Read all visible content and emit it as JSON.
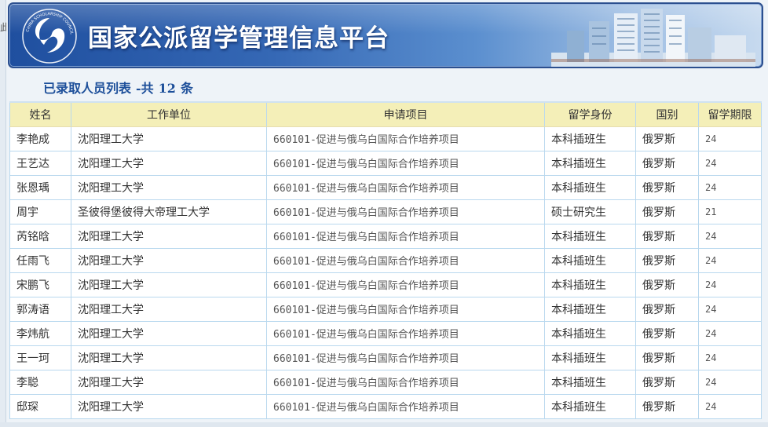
{
  "header": {
    "title": "国家公派留学管理信息平台",
    "logo_text": "CHINA SCHOLARSHIP COUNCIL"
  },
  "list": {
    "title": "已录取人员列表",
    "total_prefix": "-共",
    "total_count": "12",
    "total_suffix": "条"
  },
  "table": {
    "headers": [
      "姓名",
      "工作单位",
      "申请项目",
      "留学身份",
      "国别",
      "留学期限"
    ],
    "rows": [
      [
        "李艳成",
        "沈阳理工大学",
        "660101-促进与俄乌白国际合作培养项目",
        "本科插班生",
        "俄罗斯",
        "24"
      ],
      [
        "王艺达",
        "沈阳理工大学",
        "660101-促进与俄乌白国际合作培养项目",
        "本科插班生",
        "俄罗斯",
        "24"
      ],
      [
        "张恩瑀",
        "沈阳理工大学",
        "660101-促进与俄乌白国际合作培养项目",
        "本科插班生",
        "俄罗斯",
        "24"
      ],
      [
        "周宇",
        "圣彼得堡彼得大帝理工大学",
        "660101-促进与俄乌白国际合作培养项目",
        "硕士研究生",
        "俄罗斯",
        "21"
      ],
      [
        "芮铭晗",
        "沈阳理工大学",
        "660101-促进与俄乌白国际合作培养项目",
        "本科插班生",
        "俄罗斯",
        "24"
      ],
      [
        "任雨飞",
        "沈阳理工大学",
        "660101-促进与俄乌白国际合作培养项目",
        "本科插班生",
        "俄罗斯",
        "24"
      ],
      [
        "宋鹏飞",
        "沈阳理工大学",
        "660101-促进与俄乌白国际合作培养项目",
        "本科插班生",
        "俄罗斯",
        "24"
      ],
      [
        "郭涛语",
        "沈阳理工大学",
        "660101-促进与俄乌白国际合作培养项目",
        "本科插班生",
        "俄罗斯",
        "24"
      ],
      [
        "李炜航",
        "沈阳理工大学",
        "660101-促进与俄乌白国际合作培养项目",
        "本科插班生",
        "俄罗斯",
        "24"
      ],
      [
        "王一珂",
        "沈阳理工大学",
        "660101-促进与俄乌白国际合作培养项目",
        "本科插班生",
        "俄罗斯",
        "24"
      ],
      [
        "李聪",
        "沈阳理工大学",
        "660101-促进与俄乌白国际合作培养项目",
        "本科插班生",
        "俄罗斯",
        "24"
      ],
      [
        "邸琛",
        "沈阳理工大学",
        "660101-促进与俄乌白国际合作培养项目",
        "本科插班生",
        "俄罗斯",
        "24"
      ]
    ]
  },
  "edge": {
    "char": "此"
  },
  "colors": {
    "banner": "#3568b5",
    "header_row": "#f4efb8",
    "grid": "#b9d8ee",
    "list_title": "#1d4f9a"
  }
}
